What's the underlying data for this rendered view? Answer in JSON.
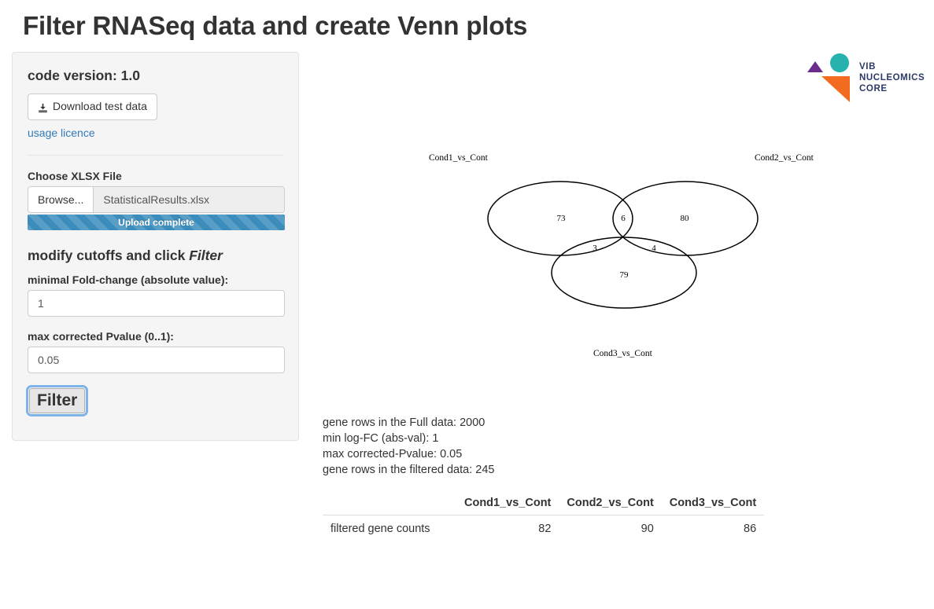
{
  "page": {
    "title": "Filter RNASeq data and create Venn plots"
  },
  "sidebar": {
    "code_version": "code version: 1.0",
    "download_button": "Download test data",
    "download_icon": "download-icon",
    "usage_licence_link": "usage licence",
    "file_section_label": "Choose XLSX File",
    "browse_button": "Browse...",
    "file_name": "StatisticalResults.xlsx",
    "upload_status": "Upload complete",
    "cutoffs_heading_prefix": "modify cutoffs and click ",
    "cutoffs_heading_emphasis": "Filter",
    "foldchange_label": "minimal Fold-change (absolute value):",
    "foldchange_value": "1",
    "pvalue_label": "max corrected Pvalue (0..1):",
    "pvalue_value": "0.05",
    "filter_button": "Filter"
  },
  "logo": {
    "line1": "VIB",
    "line2": "NUCLEOMICS",
    "line3": "CORE",
    "colors": {
      "purple": "#6b2d8b",
      "teal": "#27b2ae",
      "orange": "#f26b21",
      "text": "#2b3a67"
    }
  },
  "chart_data": {
    "type": "venn",
    "title": "",
    "sets": [
      "Cond1_vs_Cont",
      "Cond2_vs_Cont",
      "Cond3_vs_Cont"
    ],
    "labels": {
      "top_left": "Cond1_vs_Cont",
      "top_right": "Cond2_vs_Cont",
      "bottom": "Cond3_vs_Cont"
    },
    "regions": [
      {
        "id": "A_only",
        "label": "Cond1_vs_Cont only",
        "value": 73
      },
      {
        "id": "A_B",
        "label": "Cond1 & Cond2",
        "value": 6
      },
      {
        "id": "B_only",
        "label": "Cond2_vs_Cont only",
        "value": 80
      },
      {
        "id": "A_C",
        "label": "Cond1 & Cond3",
        "value": 3
      },
      {
        "id": "B_C",
        "label": "Cond2 & Cond3",
        "value": 4
      },
      {
        "id": "C_only",
        "label": "Cond3_vs_Cont only",
        "value": 79
      }
    ],
    "values": [
      73,
      6,
      80,
      3,
      4,
      79
    ],
    "legend": "none",
    "grid": false
  },
  "results": {
    "lines": [
      "gene rows in the Full data: 2000",
      "min log-FC (abs-val): 1",
      "max corrected-Pvalue: 0.05",
      "gene rows in the filtered data: 245"
    ],
    "table": {
      "columns": [
        "",
        "Cond1_vs_Cont",
        "Cond2_vs_Cont",
        "Cond3_vs_Cont"
      ],
      "rows": [
        {
          "label": "filtered gene counts",
          "values": [
            "82",
            "90",
            "86"
          ]
        }
      ]
    }
  }
}
